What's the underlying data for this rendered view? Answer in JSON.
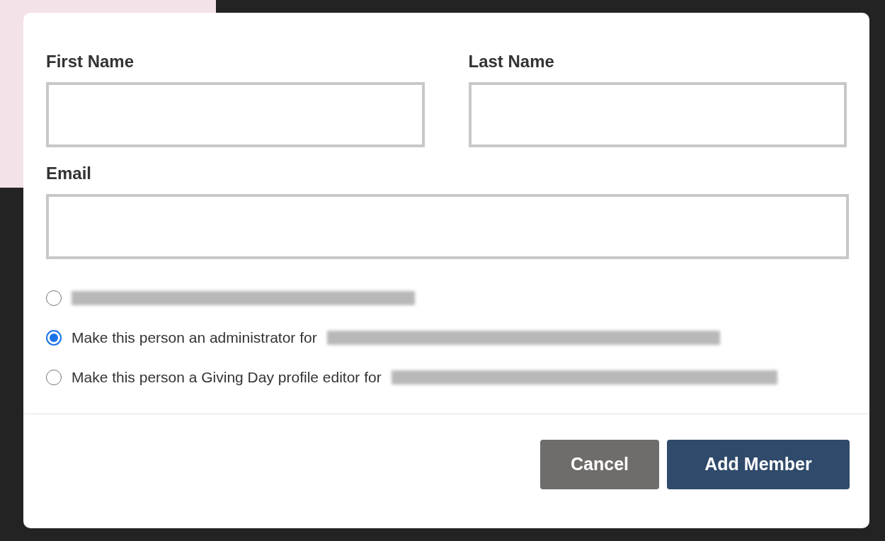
{
  "form": {
    "fields": [
      {
        "label": "First Name"
      },
      {
        "label": "Last Name"
      },
      {
        "label": "Email"
      }
    ]
  },
  "roles": [
    {
      "selected": false,
      "redacted": true
    },
    {
      "label": "Make this person an administrator for",
      "selected": true,
      "redacted": true
    },
    {
      "label": "Make this person a Giving Day profile editor for",
      "selected": false,
      "redacted": true
    }
  ],
  "buttons": [
    {
      "label": "Cancel",
      "kind": "secondary"
    },
    {
      "label": "Add Member",
      "kind": "primary"
    }
  ]
}
